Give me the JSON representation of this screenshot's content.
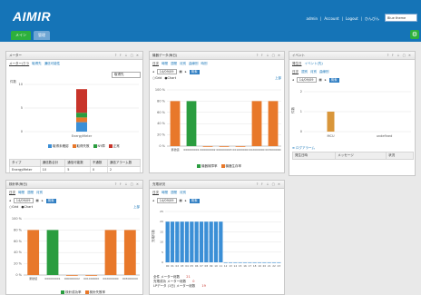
{
  "header": {
    "logo": "AIMIR",
    "links": [
      "admin",
      "Account",
      "Logout",
      "ひんびん"
    ],
    "theme": "Blue theme",
    "tabs": [
      "メイン",
      "管理"
    ]
  },
  "colors": {
    "header": "#1574b7",
    "tab_active": "#2db03c",
    "bar_orange": "#e8782a",
    "bar_green": "#2a9d3f",
    "bar_blue": "#3b8fd6",
    "bar_red": "#c8342a"
  },
  "p1": {
    "title": "メーター",
    "controls": "? ↑ ↓ ▢ ✕",
    "subtabs": [
      "メーター/クラ",
      "取得先",
      "通信可能性"
    ],
    "select": "取得先",
    "ylabel": "件数",
    "legend": [
      "取得未確認",
      "取得失敗",
      "NY障",
      "正常"
    ],
    "table": {
      "headers": [
        "タイプ",
        "通信数合計",
        "通信可能数",
        "不通数",
        "通信アラーム数"
      ],
      "rows": [
        [
          "EnergyMeter",
          "10",
          "5",
          "0",
          "2"
        ]
      ]
    },
    "chart_data": {
      "type": "bar",
      "categories": [
        "EnergyMeter"
      ],
      "series": [
        {
          "name": "取得未確認",
          "values": [
            2
          ]
        },
        {
          "name": "取得失敗",
          "values": [
            1
          ]
        },
        {
          "name": "NY障",
          "values": [
            1
          ]
        },
        {
          "name": "正常",
          "values": [
            5
          ]
        }
      ],
      "ylim": [
        0,
        10
      ]
    }
  },
  "p2": {
    "title": "機器データ(毎日)",
    "controls": "? ↑ ↓ ▢ ✕",
    "subtabs": [
      "日次",
      "時間",
      "週間",
      "月別",
      "曲線別",
      "時別"
    ],
    "date": "14/09/09",
    "btn": "検索",
    "ctype": [
      "Grid",
      "Chart"
    ],
    "link": "上部",
    "legend": [
      "機器故障率",
      "機器生存率"
    ],
    "chart_data": {
      "type": "bar",
      "categories": [
        "累積値",
        "000000001",
        "000000002",
        "000000003",
        "001000000",
        "002000000",
        "003000000"
      ],
      "values": [
        80,
        80,
        0,
        0,
        0,
        80,
        80
      ],
      "ylim": [
        0,
        100
      ],
      "yticks": [
        "100 %",
        "80 %",
        "60 %",
        "40 %",
        "20 %",
        "0 %"
      ]
    }
  },
  "p3": {
    "title": "イベント",
    "controls": "? ↑ ↓ ▢ ✕",
    "subtabs": [
      "発生日",
      "イベント(先)"
    ],
    "subtabs2": [
      "日次",
      "週別",
      "月別",
      "曲線別"
    ],
    "date": "14/09/09",
    "btn": "検索",
    "ylabel": "件数",
    "chart_data": {
      "type": "bar",
      "categories": [
        "MCU",
        "undefined"
      ],
      "values": [
        1,
        0
      ],
      "ylim": [
        0,
        2
      ]
    },
    "section": "≡ ログアラーム",
    "table_headers": [
      "発生日時",
      "メッセージ",
      "状況"
    ]
  },
  "p4": {
    "title": "検針率(毎日)",
    "controls": "? ↑ ↓ ▢ ✕",
    "subtabs": [
      "日次",
      "時間",
      "週間",
      "月別"
    ],
    "date": "14/09/09",
    "btn": "検索",
    "ctype": [
      "Grid",
      "Chart"
    ],
    "link": "上部",
    "legend": [
      "検針成功率",
      "検針失敗率"
    ],
    "chart_data": {
      "type": "bar",
      "categories": [
        "累積値",
        "000000001",
        "000000002",
        "001000000",
        "002000000",
        "003000000"
      ],
      "values": [
        80,
        80,
        0,
        0,
        80,
        80
      ],
      "ylim": [
        0,
        100
      ],
      "yticks": [
        "100 %",
        "80 %",
        "60 %",
        "40 %",
        "20 %",
        "0 %"
      ]
    }
  },
  "p5": {
    "title": "充電状況",
    "controls": "? ↑ ↓ ▢ ✕",
    "subtabs": [
      "日次",
      "時間",
      "週間",
      "月別"
    ],
    "date": "14/09/09",
    "btn": "検索",
    "ylabel": "充電件数",
    "chart_data": {
      "type": "bar",
      "categories": [
        "00",
        "01",
        "02",
        "03",
        "04",
        "05",
        "06",
        "07",
        "08",
        "09",
        "10",
        "11",
        "12",
        "13",
        "14",
        "15",
        "16",
        "17",
        "18",
        "19",
        "20",
        "21",
        "22",
        "23"
      ],
      "values": [
        20,
        20,
        20,
        20,
        20,
        20,
        20,
        20,
        20,
        20,
        20,
        20,
        0,
        0,
        0,
        0,
        0,
        0,
        0,
        0,
        0,
        0,
        0,
        0
      ],
      "ylim": [
        0,
        25
      ]
    },
    "summary": [
      {
        "label": "全件 メーター総数",
        "value": "21"
      },
      {
        "label": "充電成功 メーター総数",
        "value": "0"
      },
      {
        "label": "LPデータ (1日) メーター総数",
        "value": "19"
      }
    ]
  }
}
